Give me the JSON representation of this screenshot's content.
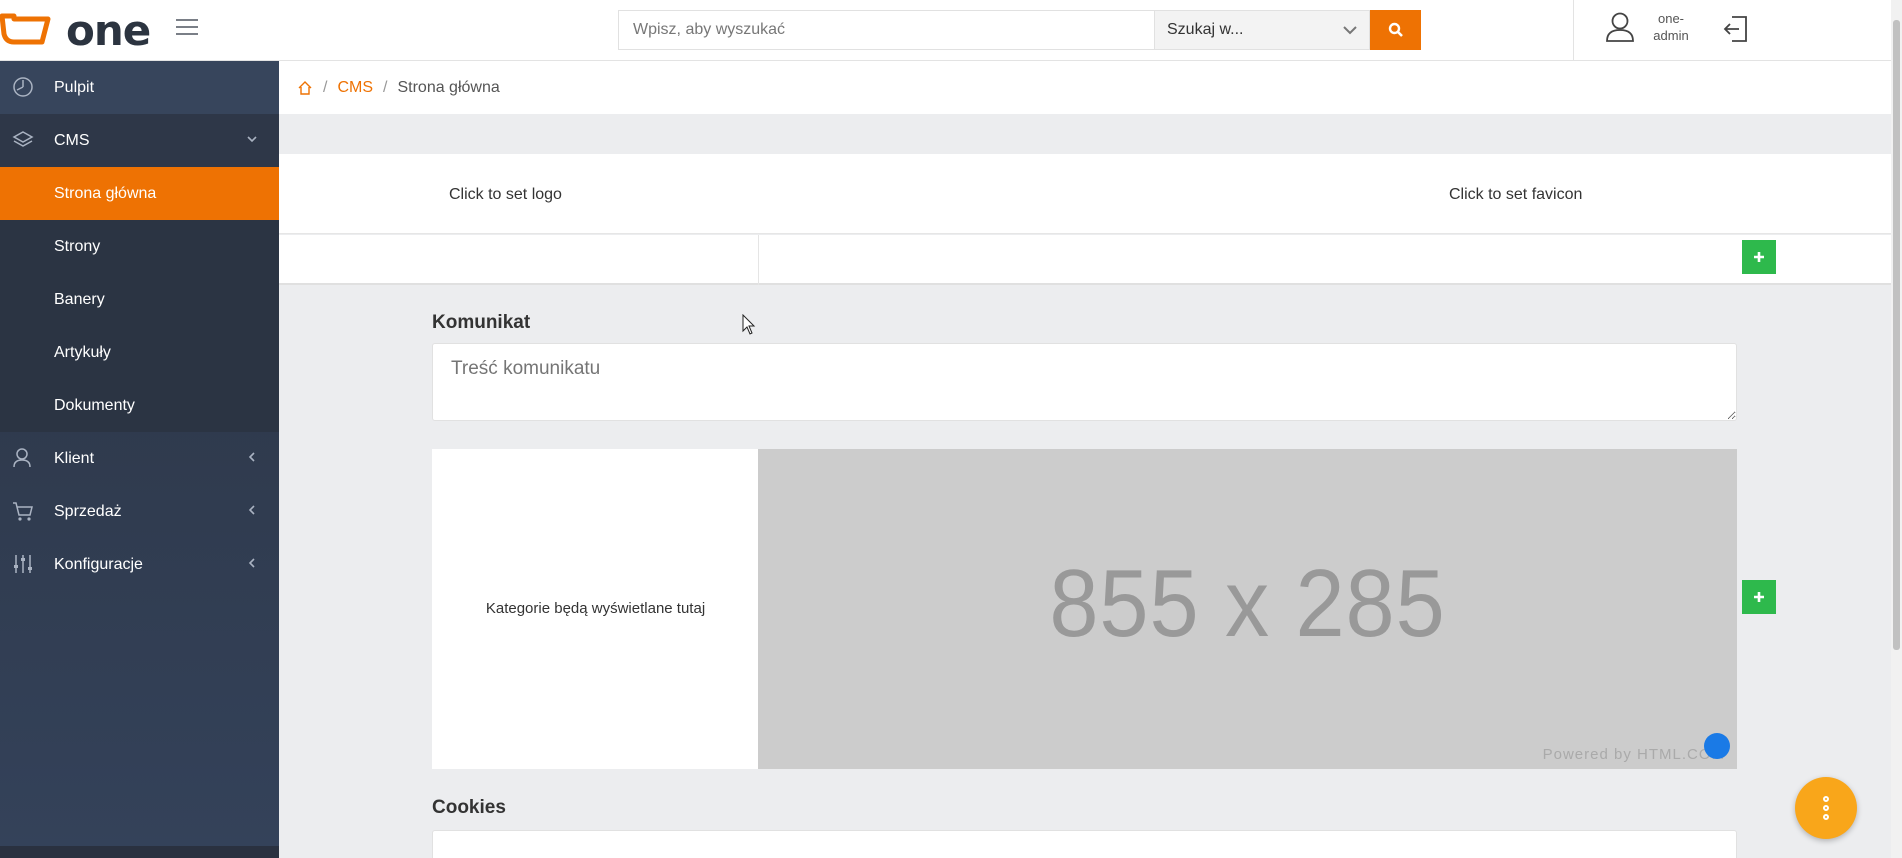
{
  "brand": {
    "name": "one",
    "accent": "#ee7203"
  },
  "header": {
    "search_placeholder": "Wpisz, aby wyszukać",
    "search_scope": "Szukaj w...",
    "user_name": "one-admin"
  },
  "sidebar": {
    "items": [
      {
        "label": "Pulpit",
        "icon": "dashboard-icon"
      },
      {
        "label": "CMS",
        "icon": "layers-icon"
      },
      {
        "label": "Strona główna"
      },
      {
        "label": "Strony"
      },
      {
        "label": "Banery"
      },
      {
        "label": "Artykuły"
      },
      {
        "label": "Dokumenty"
      },
      {
        "label": "Klient",
        "icon": "client-icon"
      },
      {
        "label": "Sprzedaż",
        "icon": "cart-icon"
      },
      {
        "label": "Konfiguracje",
        "icon": "sliders-icon"
      }
    ]
  },
  "breadcrumb": {
    "parent": "CMS",
    "current": "Strona główna"
  },
  "main": {
    "logo_slot": "Click to set logo",
    "favicon_slot": "Click to set favicon",
    "message_label": "Komunikat",
    "message_placeholder": "Treść komunikatu",
    "categories_text": "Kategorie będą wyświetlane tutaj",
    "banner_placeholder": "855 x 285",
    "banner_powered": "Powered by HTML.COM",
    "cookies_label": "Cookies"
  },
  "colors": {
    "sidebar": "#2b3443",
    "active": "#ee7203",
    "add_button": "#2eb94c",
    "fab": "#f9a61a"
  }
}
